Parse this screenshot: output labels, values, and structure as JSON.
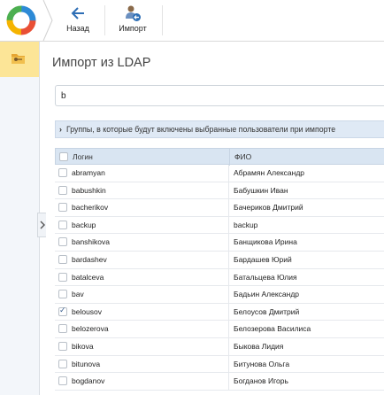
{
  "toolbar": {
    "back_label": "Назад",
    "import_label": "Импорт"
  },
  "page": {
    "title": "Импорт из LDAP",
    "search_value": "b",
    "groups_label": "Группы, в которые будут включены выбранные пользователи при импорте"
  },
  "grid": {
    "col_login": "Логин",
    "col_fio": "ФИО",
    "rows": [
      {
        "login": "abramyan",
        "fio": "Абрамян Александр",
        "checked": false
      },
      {
        "login": "babushkin",
        "fio": "Бабушкин Иван",
        "checked": false
      },
      {
        "login": "bacherikov",
        "fio": "Бачериков Дмитрий",
        "checked": false
      },
      {
        "login": "backup",
        "fio": "backup",
        "checked": false
      },
      {
        "login": "banshikova",
        "fio": "Банщикова Ирина",
        "checked": false
      },
      {
        "login": "bardashev",
        "fio": "Бардашев Юрий",
        "checked": false
      },
      {
        "login": "batalceva",
        "fio": "Батальцева Юлия",
        "checked": false
      },
      {
        "login": "bav",
        "fio": "Бадьин Александр",
        "checked": false
      },
      {
        "login": "belousov",
        "fio": "Белоусов Дмитрий",
        "checked": true
      },
      {
        "login": "belozerova",
        "fio": "Белозерова Василиса",
        "checked": false
      },
      {
        "login": "bikova",
        "fio": "Быкова Лидия",
        "checked": false
      },
      {
        "login": "bitunova",
        "fio": "Битунова Ольга",
        "checked": false
      },
      {
        "login": "bogdanov",
        "fio": "Богданов Игорь",
        "checked": false
      }
    ]
  },
  "colors": {
    "accent": "#2d6eb5",
    "rail_active": "#fce597",
    "header_bg": "#d9e5f2"
  },
  "icons": [
    "app-logo-icon",
    "back-arrow-icon",
    "import-users-icon",
    "folder-key-icon",
    "chevron-right-icon"
  ]
}
